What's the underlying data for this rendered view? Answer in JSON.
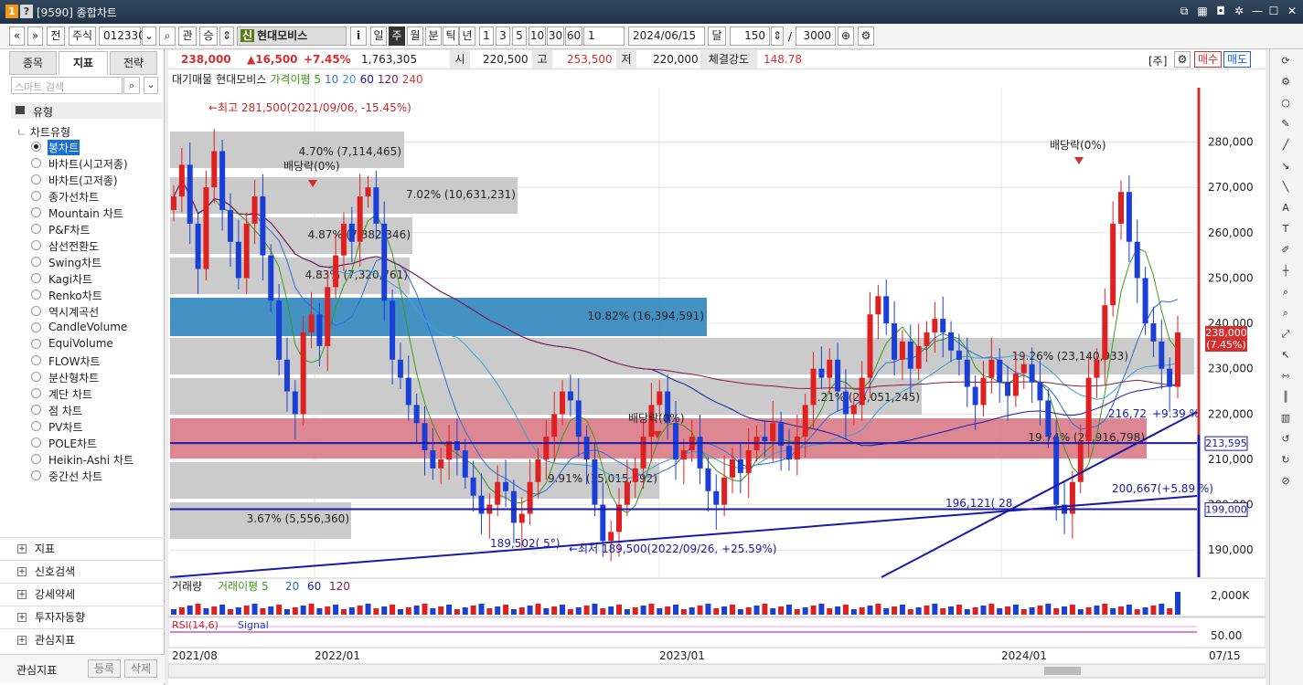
{
  "window": {
    "code": "[9590]",
    "title": "종합차트",
    "badge1": "1",
    "badge2": "?"
  },
  "toolbar": {
    "nav_prev": "«",
    "nav_next": "»",
    "prev": "전",
    "market": "주식",
    "code": "012330",
    "dropdown": "⌄",
    "search": "⌕",
    "rel": "관",
    "sort": "승",
    "updown": "⇕",
    "credit_badge": "신",
    "stock_name": "현대모비스",
    "info": "i",
    "periods": [
      "일",
      "주",
      "월",
      "분",
      "틱",
      "년"
    ],
    "period_selected": "주",
    "intervals": [
      "1",
      "3",
      "5",
      "10",
      "30",
      "60"
    ],
    "count_field": "1",
    "date": "2024/06/15",
    "cal_label": "달",
    "bars_count": "150",
    "slash": "/",
    "max_count": "3000"
  },
  "left_panel": {
    "tabs": [
      "종목",
      "지표",
      "전략"
    ],
    "active_tab": "지표",
    "search_placeholder": "스마트 검색",
    "root": "유형",
    "group": "차트유형",
    "chart_types": [
      "봉차트",
      "바차트(시고저종)",
      "바차트(고저종)",
      "종가선차트",
      "Mountain 차트",
      "P&F차트",
      "삼선전환도",
      "Swing차트",
      "Kagi차트",
      "Renko차트",
      "역시계곡선",
      "CandleVolume",
      "EquiVolume",
      "FLOW차트",
      "분산형차트",
      "계단 차트",
      "점 차트",
      "PV차트",
      "POLE차트",
      "Heikin-Ashi 차트",
      "중간선 차트"
    ],
    "selected": "봉차트",
    "sections": [
      "지표",
      "신호검색",
      "강세약세",
      "투자자동향",
      "관심지표"
    ],
    "fav_label": "관심지표",
    "fav_add": "등록",
    "fav_del": "삭제"
  },
  "price_bar": {
    "price": "238,000",
    "change": "▲16,500",
    "pct": "+7.45%",
    "volume": "1,763,305",
    "open_label": "시",
    "open": "220,500",
    "high_label": "고",
    "high": "253,500",
    "low_label": "저",
    "low": "220,000",
    "strength_label": "체결강도",
    "strength": "148.78",
    "unit": "[주]",
    "buy": "매수",
    "sell": "매도"
  },
  "legend": {
    "items": [
      {
        "text": "대기매물",
        "color": "#222222"
      },
      {
        "text": "현대모비스",
        "color": "#222222"
      },
      {
        "text": "가격이평 5",
        "color": "#3a9a1a"
      },
      {
        "text": "10",
        "color": "#2c6fd6"
      },
      {
        "text": "20",
        "color": "#3aa0d8"
      },
      {
        "text": "60",
        "color": "#1a1aa8"
      },
      {
        "text": "120",
        "color": "#8a1a4a"
      },
      {
        "text": "240",
        "color": "#d63a3a"
      }
    ]
  },
  "chart_data": {
    "type": "candlestick",
    "interval": "weekly",
    "x_ticks": [
      "2021/08",
      "2022/01",
      "2023/01",
      "2024/01"
    ],
    "x_end_label": "07/15",
    "y_ticks": [
      190000,
      200000,
      210000,
      220000,
      230000,
      240000,
      250000,
      260000,
      270000,
      280000
    ],
    "y_tick_labels": [
      "190,000",
      "200,000",
      "210,000",
      "220,000",
      "230,000",
      "240,000",
      "250,000",
      "260,000",
      "270,000",
      "280,000"
    ],
    "ylim": [
      184000,
      292000
    ],
    "closes": [
      268000,
      275000,
      262000,
      252000,
      270000,
      278000,
      265000,
      258000,
      250000,
      262000,
      268000,
      255000,
      245000,
      232000,
      225000,
      220000,
      238000,
      242000,
      235000,
      248000,
      255000,
      262000,
      258000,
      268000,
      270000,
      262000,
      245000,
      232000,
      228000,
      222000,
      218000,
      212000,
      208000,
      210000,
      214000,
      212000,
      206000,
      202000,
      198000,
      200000,
      205000,
      203000,
      196000,
      198000,
      205000,
      210000,
      215000,
      220000,
      225000,
      223000,
      215000,
      210000,
      200000,
      192000,
      194000,
      200000,
      205000,
      208000,
      215000,
      222000,
      225000,
      218000,
      210000,
      212000,
      215000,
      208000,
      203000,
      200000,
      206000,
      210000,
      207000,
      212000,
      215000,
      214000,
      218000,
      213000,
      210000,
      215000,
      222000,
      230000,
      228000,
      232000,
      225000,
      220000,
      222000,
      228000,
      242000,
      246000,
      240000,
      232000,
      236000,
      230000,
      235000,
      238000,
      241000,
      238000,
      234000,
      232000,
      226000,
      222000,
      228000,
      232000,
      227000,
      224000,
      229000,
      231000,
      227000,
      223000,
      215000,
      200000,
      198000,
      205000,
      214000,
      228000,
      232000,
      244000,
      262000,
      269000,
      258000,
      250000,
      240000,
      236000,
      230000,
      226000,
      238000
    ],
    "ma_labels": [
      "가격이평 5",
      "10",
      "20",
      "60",
      "120",
      "240"
    ],
    "annotations": [
      {
        "text": "←최고 281,500(2021/09/06, -15.45%)",
        "color": "#c62828"
      },
      {
        "text": "배당락(0%)",
        "color": "#222222"
      },
      {
        "text": "배당락(0%)",
        "color": "#222222"
      },
      {
        "text": "배당락(0%)",
        "color": "#222222"
      },
      {
        "text": "189,502( 5°)",
        "color": "#1a1aa8"
      },
      {
        "text": "←최저 189,500(2022/09/26, +25.59%)",
        "color": "#1a1aa8"
      },
      {
        "text": "216,72",
        "color": "#1a1aa8"
      },
      {
        "text": "+9.39 %",
        "color": "#1a1aa8"
      },
      {
        "text": "200,667(+5.89 %)",
        "color": "#1a1aa8"
      },
      {
        "text": "196,121( 28",
        "color": "#1a1aa8"
      }
    ],
    "volume_profile": [
      {
        "label": "4.70% (7,114,465)"
      },
      {
        "label": "7.02% (10,631,231)"
      },
      {
        "label": "4.87% (7,382,346)"
      },
      {
        "label": "4.83% (7,320,761)"
      },
      {
        "label": "10.82% (16,394,591)"
      },
      {
        "label": "19.26% (23,140,933)"
      },
      {
        "label": ".21% (23,051,245)"
      },
      {
        "label": "19.74% (29,916,798)"
      },
      {
        "label": "9.91% (15,015,892)"
      },
      {
        "label": "3.67% (5,556,360)"
      }
    ],
    "price_tags": [
      {
        "text": "238,000",
        "sub": "(7.45%)",
        "bg": "#d32f2f"
      },
      {
        "text": "213,595",
        "bg": "#ffffff"
      },
      {
        "text": "199,000",
        "bg": "#ffffff"
      }
    ],
    "volume_panel": {
      "legend": [
        "거래량",
        "거래이평 5",
        "20",
        "60",
        "120"
      ],
      "y_label": "2,000K"
    },
    "rsi_panel": {
      "legend": [
        "RSI(14,6)",
        "Signal"
      ],
      "y_label": "50.00"
    }
  }
}
